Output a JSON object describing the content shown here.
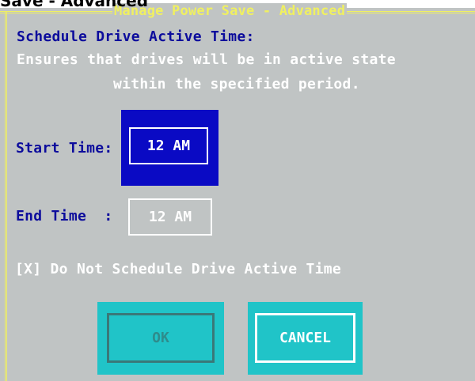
{
  "page_caption": "Save - Advanced",
  "dialog": {
    "title": "Manage Power Save - Advanced",
    "heading": "Schedule Drive Active Time:",
    "description_line1": "Ensures that drives will be in active state",
    "description_line2": "within the specified period."
  },
  "start_time": {
    "label": "Start Time:",
    "value": "12 AM"
  },
  "end_time": {
    "label": "End Time  :",
    "value": "12 AM"
  },
  "checkbox": {
    "text": "[X] Do Not Schedule Drive Active Time"
  },
  "buttons": {
    "ok_label": "OK",
    "cancel_label": "CANCEL"
  },
  "colors": {
    "background": "#c0c4c4",
    "frame": "#f0f060",
    "label_blue": "#0c0c9c",
    "focus_blue": "#0a0ac4",
    "button_cyan": "#20c4c8"
  }
}
